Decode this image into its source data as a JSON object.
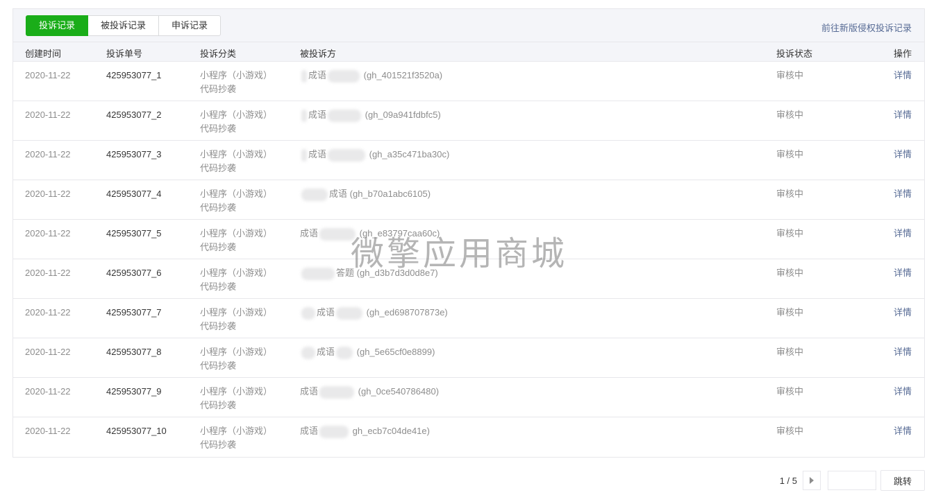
{
  "tabs": [
    {
      "label": "投诉记录",
      "active": true
    },
    {
      "label": "被投诉记录",
      "active": false
    },
    {
      "label": "申诉记录",
      "active": false
    }
  ],
  "new_version_link": "前往新版侵权投诉记录",
  "columns": {
    "created_time": "创建时间",
    "complaint_no": "投诉单号",
    "category": "投诉分类",
    "target": "被投诉方",
    "status": "投诉状态",
    "operation": "操作"
  },
  "rows": [
    {
      "date": "2020-11-22",
      "no": "425953077_1",
      "category_line1": "小程序（小游戏）",
      "category_line2": "代码抄袭",
      "target_visible": "成语",
      "target_id": "(gh_401521f3520a)",
      "status": "审核中",
      "op": "详情"
    },
    {
      "date": "2020-11-22",
      "no": "425953077_2",
      "category_line1": "小程序（小游戏）",
      "category_line2": "代码抄袭",
      "target_visible": "成语",
      "target_id": "(gh_09a941fdbfc5)",
      "status": "审核中",
      "op": "详情"
    },
    {
      "date": "2020-11-22",
      "no": "425953077_3",
      "category_line1": "小程序（小游戏）",
      "category_line2": "代码抄袭",
      "target_visible": "成语",
      "target_id": "(gh_a35c471ba30c)",
      "status": "审核中",
      "op": "详情"
    },
    {
      "date": "2020-11-22",
      "no": "425953077_4",
      "category_line1": "小程序（小游戏）",
      "category_line2": "代码抄袭",
      "target_visible": "成语",
      "target_id": "(gh_b70a1abc6105)",
      "status": "审核中",
      "op": "详情"
    },
    {
      "date": "2020-11-22",
      "no": "425953077_5",
      "category_line1": "小程序（小游戏）",
      "category_line2": "代码抄袭",
      "target_visible": "成语",
      "target_id": "(gh_e83797caa60c)",
      "status": "审核中",
      "op": "详情"
    },
    {
      "date": "2020-11-22",
      "no": "425953077_6",
      "category_line1": "小程序（小游戏）",
      "category_line2": "代码抄袭",
      "target_visible": "答题",
      "target_id": "(gh_d3b7d3d0d8e7)",
      "status": "审核中",
      "op": "详情"
    },
    {
      "date": "2020-11-22",
      "no": "425953077_7",
      "category_line1": "小程序（小游戏）",
      "category_line2": "代码抄袭",
      "target_visible": "成语",
      "target_id": "(gh_ed698707873e)",
      "status": "审核中",
      "op": "详情"
    },
    {
      "date": "2020-11-22",
      "no": "425953077_8",
      "category_line1": "小程序（小游戏）",
      "category_line2": "代码抄袭",
      "target_visible": "成语",
      "target_id": "(gh_5e65cf0e8899)",
      "status": "审核中",
      "op": "详情"
    },
    {
      "date": "2020-11-22",
      "no": "425953077_9",
      "category_line1": "小程序（小游戏）",
      "category_line2": "代码抄袭",
      "target_visible": "成语",
      "target_id": "(gh_0ce540786480)",
      "status": "审核中",
      "op": "详情"
    },
    {
      "date": "2020-11-22",
      "no": "425953077_10",
      "category_line1": "小程序（小游戏）",
      "category_line2": "代码抄袭",
      "target_visible": "成语",
      "target_id": "gh_ecb7c04de41e)",
      "status": "审核中",
      "op": "详情"
    }
  ],
  "watermark": "微擎应用商城",
  "pagination": {
    "info": "1 / 5",
    "jump_label": "跳转",
    "input_value": ""
  }
}
